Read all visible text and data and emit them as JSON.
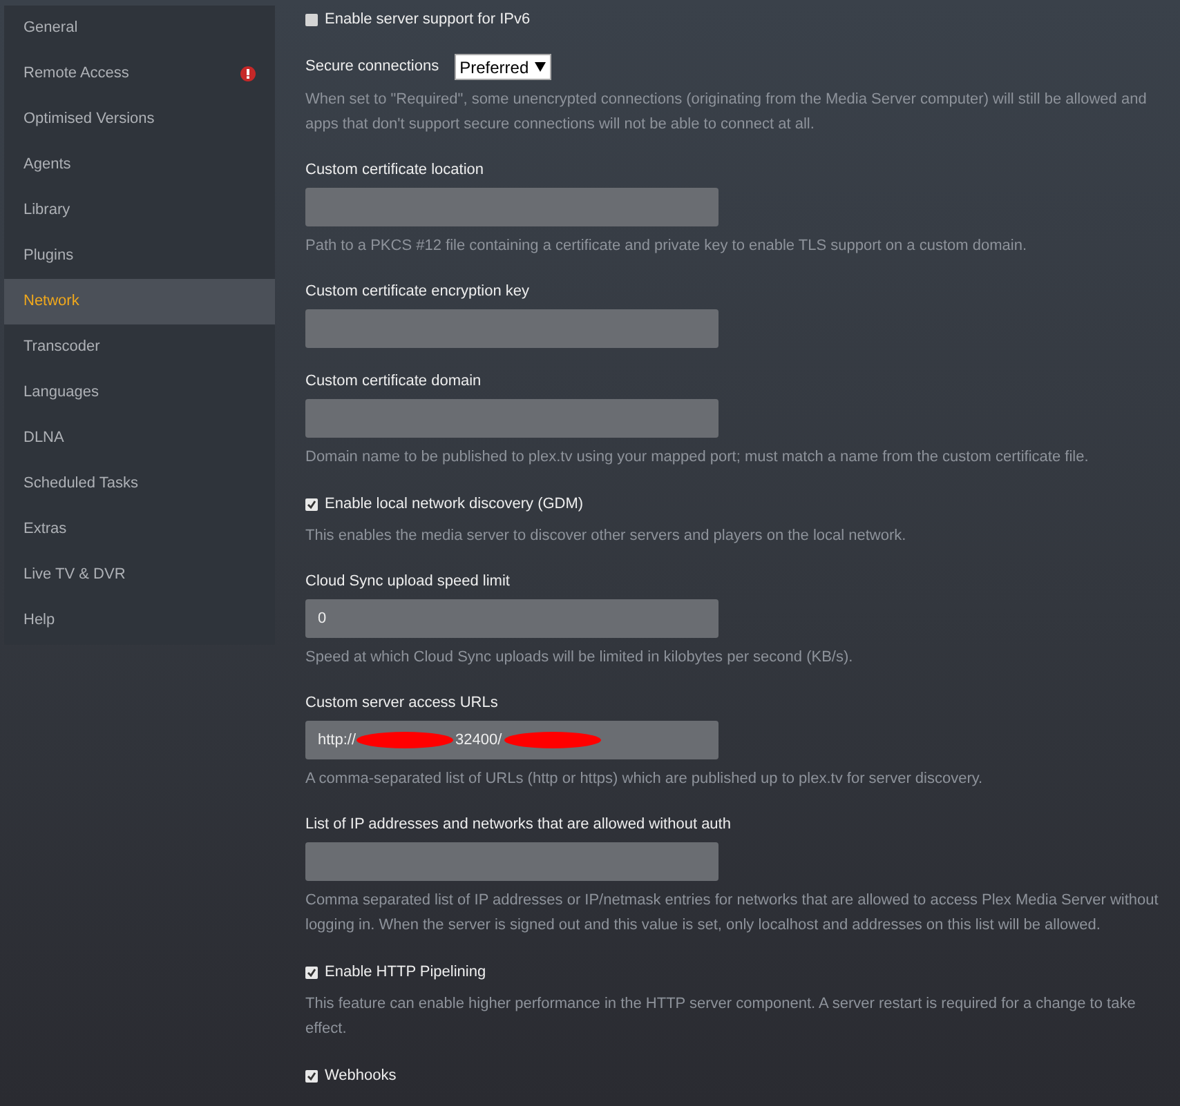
{
  "sidebar": {
    "items": [
      {
        "label": "General",
        "selected": false,
        "alert": false
      },
      {
        "label": "Remote Access",
        "selected": false,
        "alert": true
      },
      {
        "label": "Optimised Versions",
        "selected": false,
        "alert": false
      },
      {
        "label": "Agents",
        "selected": false,
        "alert": false
      },
      {
        "label": "Library",
        "selected": false,
        "alert": false
      },
      {
        "label": "Plugins",
        "selected": false,
        "alert": false
      },
      {
        "label": "Network",
        "selected": true,
        "alert": false
      },
      {
        "label": "Transcoder",
        "selected": false,
        "alert": false
      },
      {
        "label": "Languages",
        "selected": false,
        "alert": false
      },
      {
        "label": "DLNA",
        "selected": false,
        "alert": false
      },
      {
        "label": "Scheduled Tasks",
        "selected": false,
        "alert": false
      },
      {
        "label": "Extras",
        "selected": false,
        "alert": false
      },
      {
        "label": "Live TV & DVR",
        "selected": false,
        "alert": false
      },
      {
        "label": "Help",
        "selected": false,
        "alert": false
      }
    ]
  },
  "settings": [
    {
      "kind": "checkbox",
      "label": "Enable server support for IPv6",
      "checked": false
    },
    {
      "kind": "select",
      "label": "Secure connections",
      "value": "Preferred",
      "description": "When set to \"Required\", some unencrypted connections (originating from the Media Server computer) will still be allowed and apps that don't support secure connections will not be able to connect at all."
    },
    {
      "kind": "field",
      "label": "Custom certificate location",
      "description": "Path to a PKCS #12 file containing a certificate and private key to enable TLS support on a custom domain."
    },
    {
      "kind": "field",
      "label": "Custom certificate encryption key"
    },
    {
      "kind": "field",
      "label": "Custom certificate domain",
      "description": "Domain name to be published to plex.tv using your mapped port; must match a name from the custom certificate file."
    },
    {
      "kind": "checkbox",
      "label": "Enable local network discovery (GDM)",
      "checked": true,
      "description": "This enables the media server to discover other servers and players on the local network."
    },
    {
      "kind": "field",
      "label": "Cloud Sync upload speed limit",
      "value": "0",
      "description": "Speed at which Cloud Sync uploads will be limited in kilobytes per second (KB/s)."
    },
    {
      "kind": "redacted_field",
      "label": "Custom server access URLs",
      "value_parts": [
        "http://",
        "32400/"
      ],
      "description": "A comma-separated list of URLs (http or https) which are published up to plex.tv for server discovery."
    },
    {
      "kind": "field",
      "label": "List of IP addresses and networks that are allowed without auth",
      "description": "Comma separated list of IP addresses or IP/netmask entries for networks that are allowed to access Plex Media Server without logging in. When the server is signed out and this value is set, only localhost and addresses on this list will be allowed."
    },
    {
      "kind": "checkbox",
      "label": "Enable HTTP Pipelining",
      "checked": true,
      "description": "This feature can enable higher performance in the HTTP server component. A server restart is required for a change to take effect."
    },
    {
      "kind": "checkbox",
      "label": "Webhooks",
      "checked": true
    }
  ]
}
